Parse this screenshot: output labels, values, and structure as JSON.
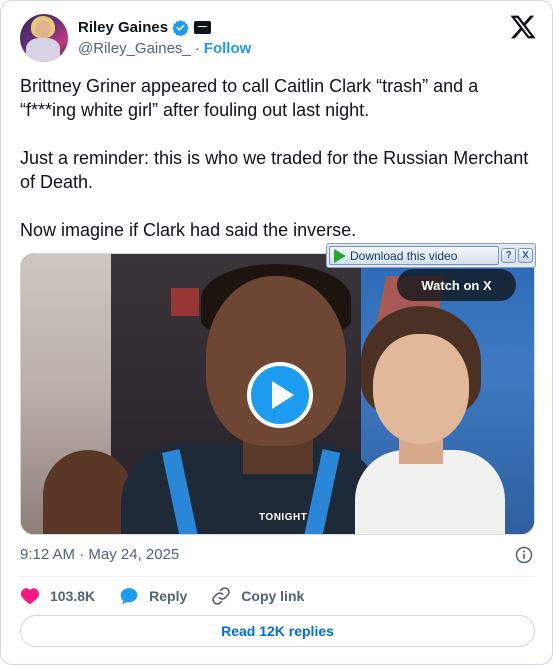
{
  "author": {
    "name": "Riley Gaines",
    "handle": "@Riley_Gaines_",
    "separator": "·",
    "follow_label": "Follow"
  },
  "tweet": {
    "paragraphs": [
      "Brittney Griner appeared to call Caitlin Clark “trash” and a “f***ing white girl” after fouling out last night.",
      "Just a reminder: this is who we traded for the Russian Merchant of Death.",
      "Now imagine if Clark had said the inverse."
    ],
    "timestamp": "9:12 AM · May 24, 2025"
  },
  "media": {
    "overlay_text": "TONIGHT",
    "watch_label": "Watch on X"
  },
  "download_toolbar": {
    "label": "Download this video",
    "help": "?",
    "close": "X"
  },
  "actions": {
    "likes": "103.8K",
    "reply_label": "Reply",
    "copy_label": "Copy link",
    "read_replies_label": "Read 12K replies"
  },
  "colors": {
    "accent": "#1d9bf0",
    "like": "#f91880",
    "link": "#006fd6",
    "muted": "#536471"
  }
}
